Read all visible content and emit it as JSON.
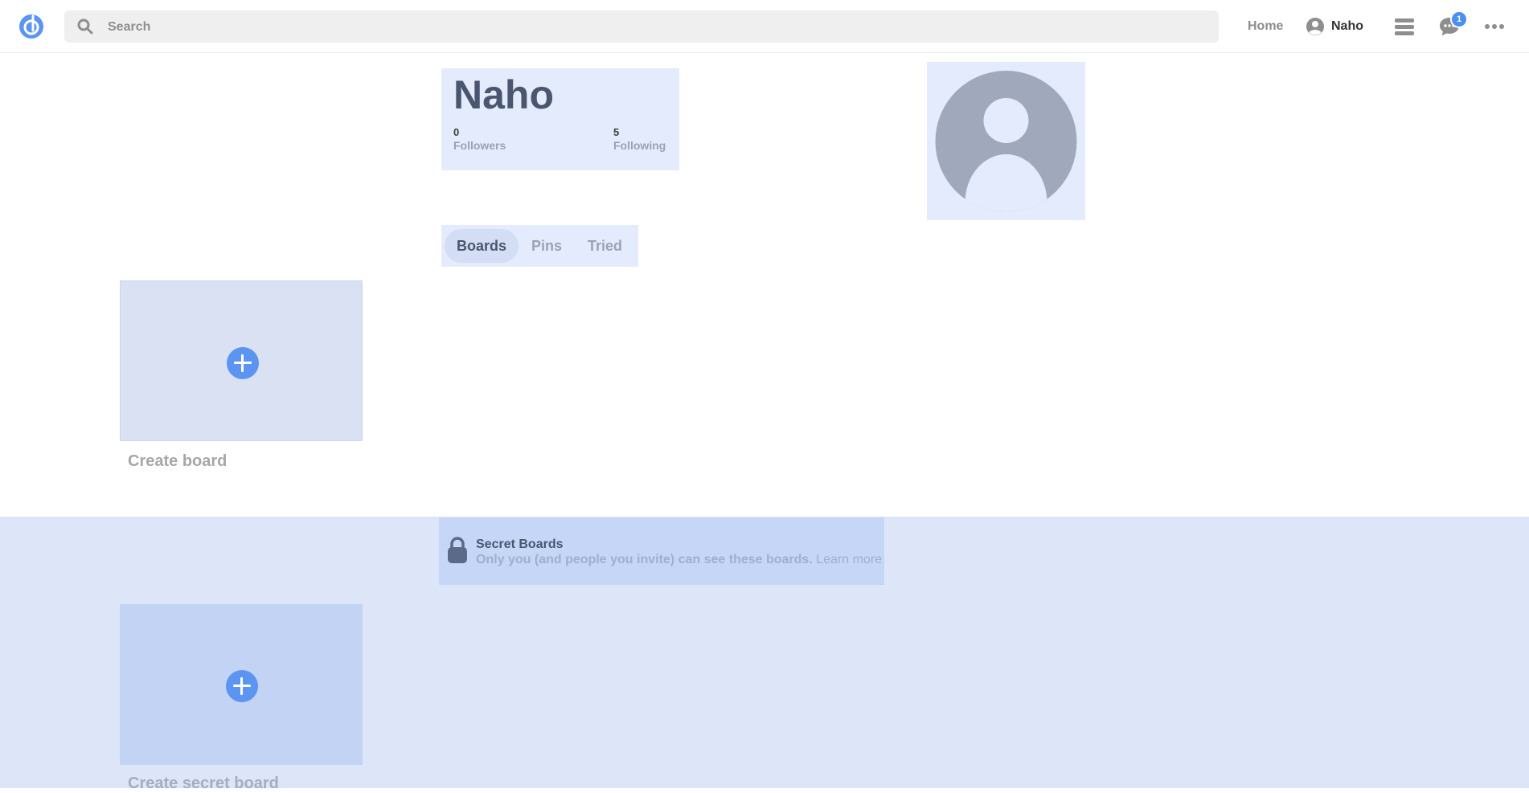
{
  "header": {
    "search_placeholder": "Search",
    "home_label": "Home",
    "user_label": "Naho",
    "notification_count": "1",
    "icons": [
      "logo-icon",
      "search-icon",
      "user-icon",
      "menu-icon",
      "chat-icon",
      "more-icon"
    ]
  },
  "profile": {
    "name": "Naho",
    "followers_count": "0",
    "followers_label": "Followers",
    "following_count": "5",
    "following_label": "Following"
  },
  "tabs": [
    {
      "label": "Boards",
      "active": true
    },
    {
      "label": "Pins",
      "active": false
    },
    {
      "label": "Tried",
      "active": false
    }
  ],
  "boards": {
    "create_label": "Create board"
  },
  "secret": {
    "title": "Secret Boards",
    "description": "Only you (and people you invite) can see these boards.",
    "learn_more": "Learn more",
    "create_label": "Create secret board"
  },
  "colors": {
    "accent": "#5b95f1",
    "badge": "#4a90f0",
    "panel": "#e3ebfc",
    "secret_bg": "#dde6f8"
  }
}
